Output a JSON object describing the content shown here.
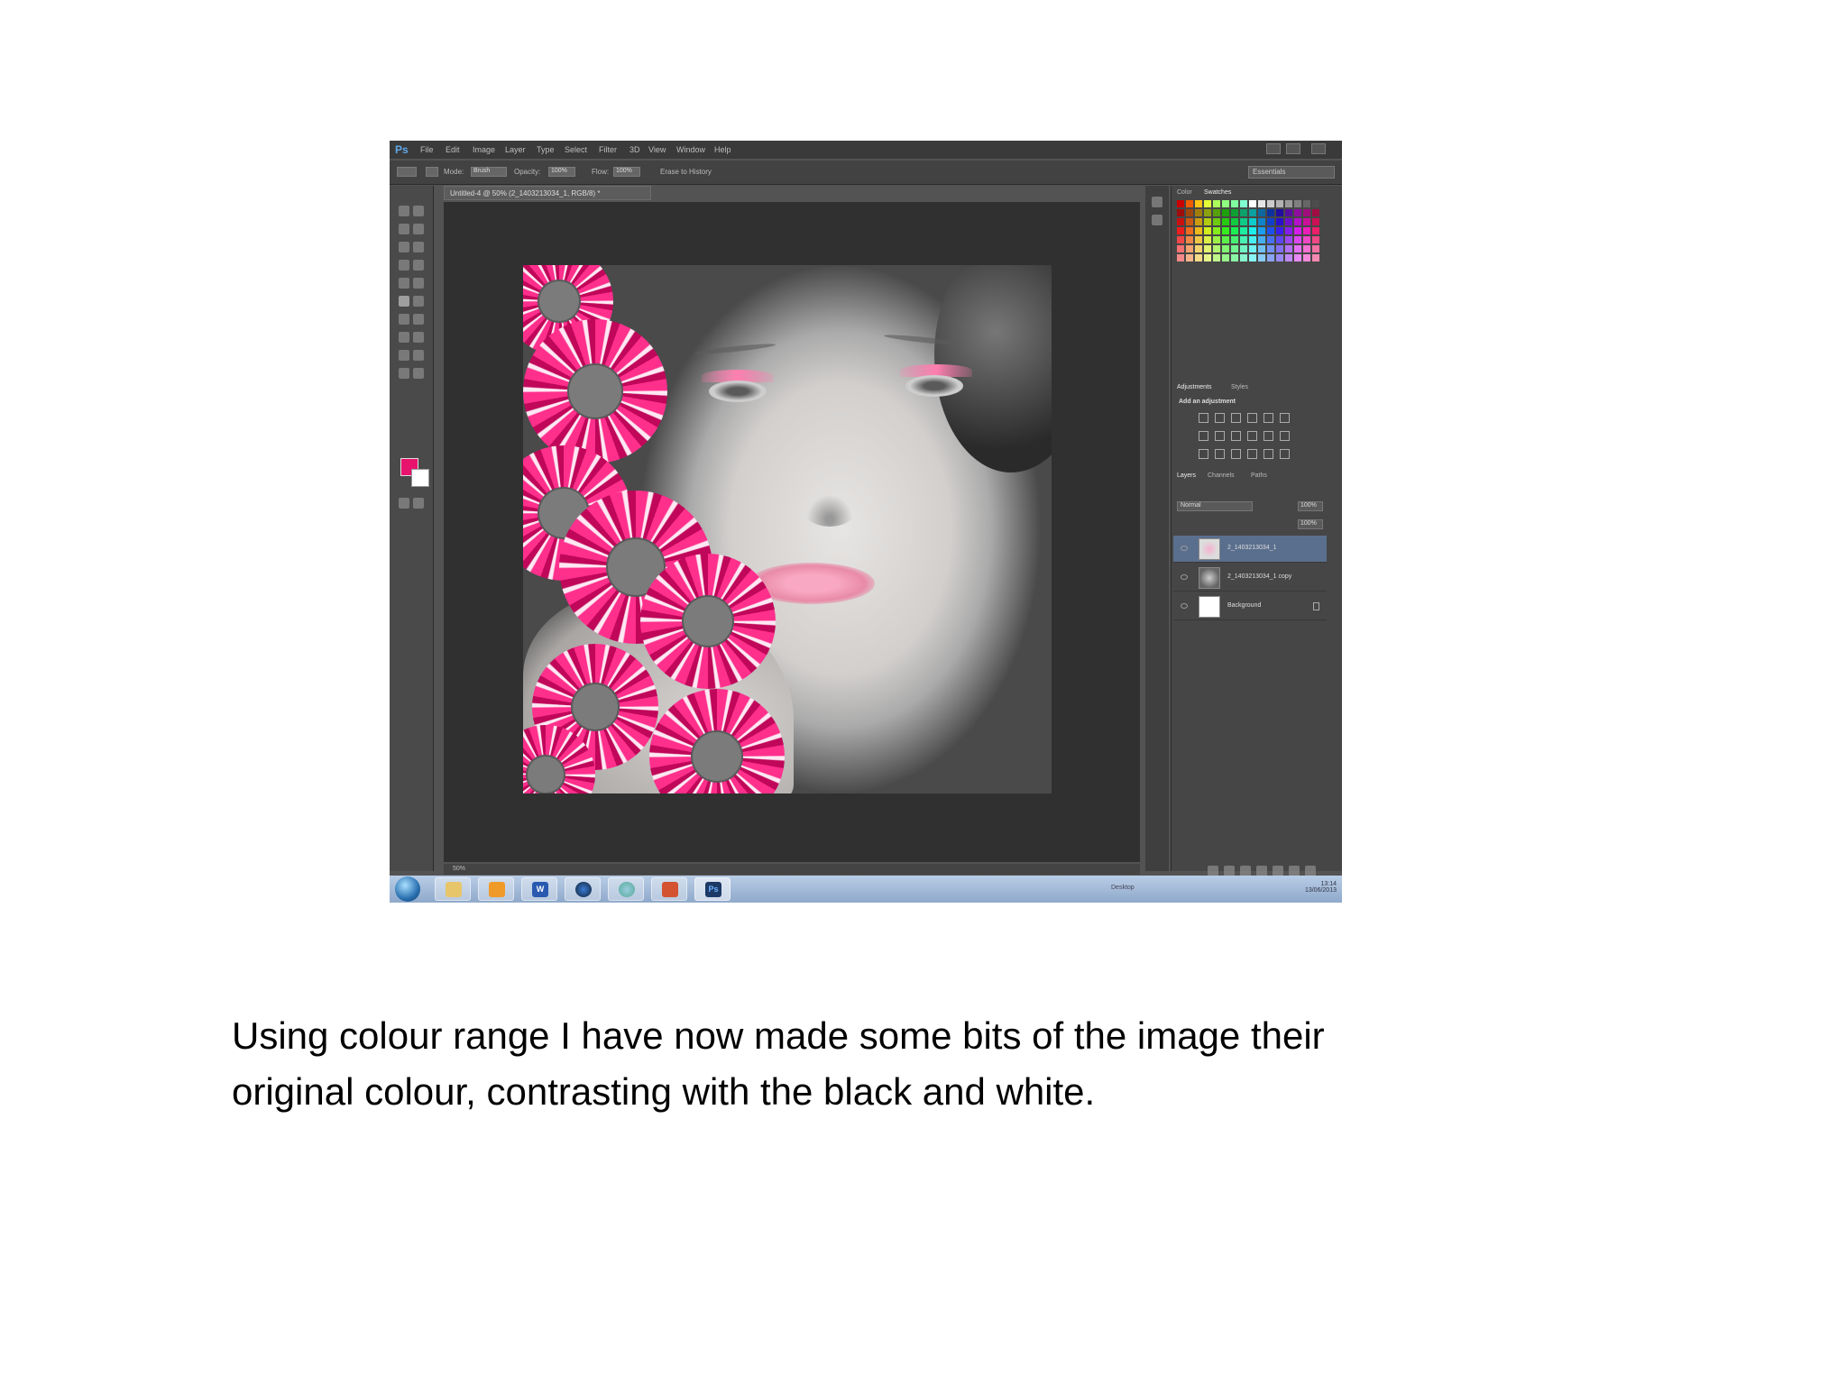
{
  "screenshot": {
    "app": "Adobe Photoshop",
    "logo": "Ps",
    "menu": [
      "File",
      "Edit",
      "Image",
      "Layer",
      "Type",
      "Select",
      "Filter",
      "3D",
      "View",
      "Window",
      "Help"
    ],
    "workspace": "Essentials",
    "document_tab": "Untitled-4 @ 50% (2_1403213034_1, RGB/8) *",
    "options_bar": {
      "mode_label": "Mode:",
      "mode_value": "Brush",
      "opacity_label": "Opacity:",
      "opacity_value": "100%",
      "flow_label": "Flow:",
      "flow_value": "100%",
      "erase_to_history": "Erase to History"
    },
    "status": "50%",
    "foreground_color": "#e8136d",
    "background_color": "#ffffff",
    "panels": {
      "color_tabs": [
        "Color",
        "Swatches"
      ],
      "adjustments_tabs": [
        "Adjustments",
        "Styles"
      ],
      "adjustments_heading": "Add an adjustment",
      "layers_tabs": [
        "Layers",
        "Channels",
        "Paths"
      ],
      "blend_mode": "Normal",
      "opacity": "100%",
      "fill": "100%",
      "layers": [
        {
          "name": "2_1403213034_1",
          "selected": true
        },
        {
          "name": "2_1403213034_1 copy",
          "selected": false
        },
        {
          "name": "Background",
          "selected": false
        }
      ]
    },
    "taskbar": {
      "apps": [
        "explorer-icon",
        "outlook-icon",
        "word-icon",
        "firefox-icon",
        "chrome-icon",
        "powerpoint-icon",
        "photoshop-icon"
      ],
      "ps_label": "Ps",
      "w_label": "W",
      "tray_label": "Desktop",
      "time": "13:14",
      "date": "13/06/2013"
    }
  },
  "caption": {
    "line1": "Using colour range I have now made some bits of the image their",
    "line2": "original colour, contrasting with the black and white."
  }
}
